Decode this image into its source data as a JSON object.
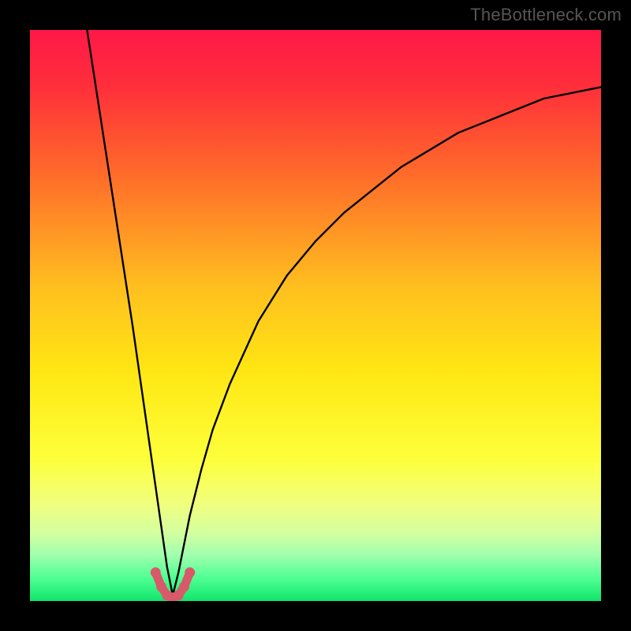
{
  "watermark": "TheBottleneck.com",
  "chart_data": {
    "type": "line",
    "title": "",
    "xlabel": "",
    "ylabel": "",
    "xlim": [
      0,
      100
    ],
    "ylim": [
      0,
      100
    ],
    "grid": false,
    "legend": false,
    "notes": "Heatmap gradient background from red (top, high bottleneck) through orange/yellow to green (bottom, low bottleneck). Two black curves descend toward a common minimum near x≈25, y≈0; a short red U-shaped marker segment sits at the trough.",
    "series": [
      {
        "name": "curve-left",
        "color": "#000000",
        "x": [
          10,
          12,
          14,
          16,
          18,
          20,
          21,
          22,
          23,
          24,
          25
        ],
        "values": [
          100,
          87,
          74,
          61,
          48,
          34,
          27,
          20,
          13,
          6,
          1
        ]
      },
      {
        "name": "curve-right",
        "color": "#000000",
        "x": [
          25,
          26,
          27,
          28,
          29,
          30,
          32,
          35,
          40,
          45,
          50,
          55,
          60,
          65,
          70,
          75,
          80,
          85,
          90,
          95,
          100
        ],
        "values": [
          1,
          5,
          10,
          15,
          19,
          23,
          30,
          38,
          49,
          57,
          63,
          68,
          72,
          76,
          79,
          82,
          84,
          86,
          88,
          89,
          90
        ]
      },
      {
        "name": "marker-trough",
        "color": "#d85a6a",
        "x": [
          22,
          23,
          24,
          25,
          26,
          27,
          28
        ],
        "values": [
          5,
          2.5,
          1,
          0.6,
          1,
          2.5,
          5
        ]
      }
    ],
    "background_gradient_stops": [
      {
        "pct": 0,
        "color": "#ff1848"
      },
      {
        "pct": 10,
        "color": "#ff2f3a"
      },
      {
        "pct": 25,
        "color": "#ff6a2a"
      },
      {
        "pct": 45,
        "color": "#ffbf1f"
      },
      {
        "pct": 60,
        "color": "#ffe713"
      },
      {
        "pct": 75,
        "color": "#fdff3a"
      },
      {
        "pct": 83,
        "color": "#f1ff7e"
      },
      {
        "pct": 88,
        "color": "#d4ffa0"
      },
      {
        "pct": 92,
        "color": "#9fffad"
      },
      {
        "pct": 96,
        "color": "#4fff93"
      },
      {
        "pct": 100,
        "color": "#10e56b"
      }
    ]
  }
}
